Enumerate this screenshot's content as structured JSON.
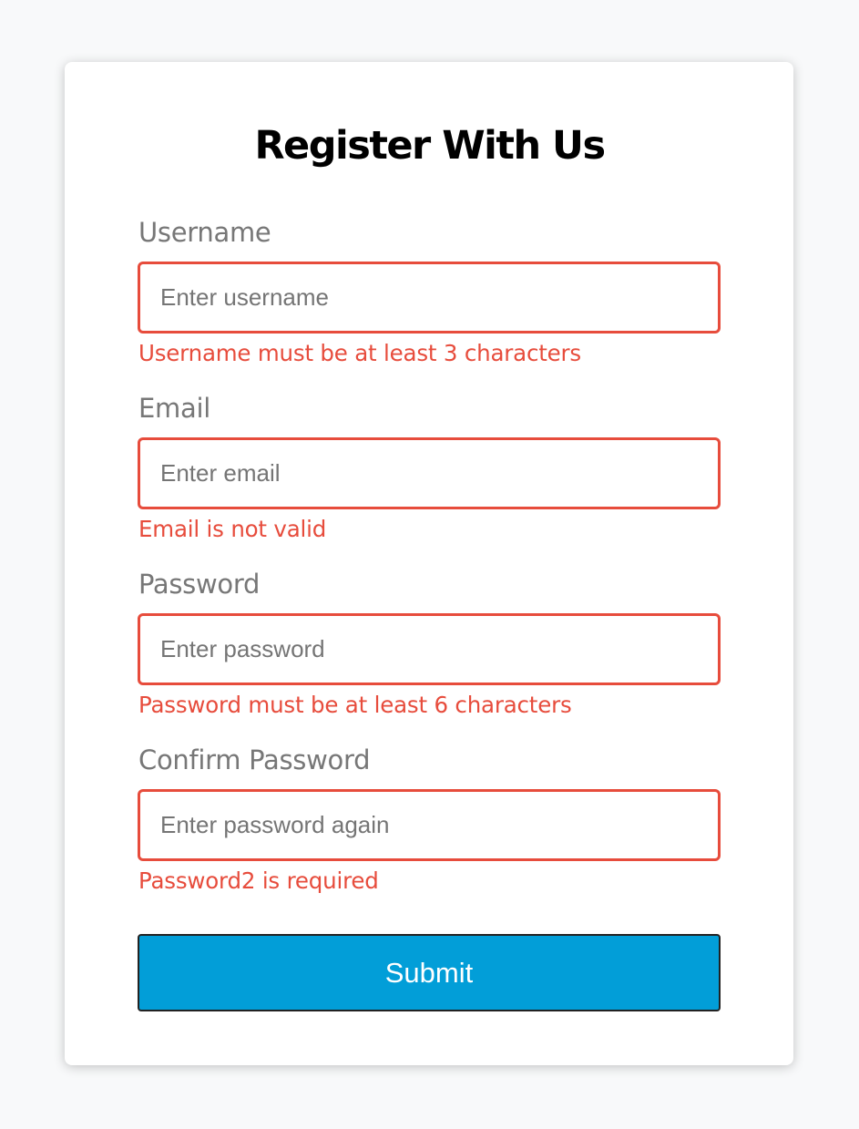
{
  "form": {
    "title": "Register With Us",
    "fields": [
      {
        "label": "Username",
        "placeholder": "Enter username",
        "type": "text",
        "error": "Username must be at least 3 characters"
      },
      {
        "label": "Email",
        "placeholder": "Enter email",
        "type": "text",
        "error": "Email is not valid"
      },
      {
        "label": "Password",
        "placeholder": "Enter password",
        "type": "password",
        "error": "Password must be at least 6 characters"
      },
      {
        "label": "Confirm Password",
        "placeholder": "Enter password again",
        "type": "password",
        "error": "Password2 is required"
      }
    ],
    "submit_label": "Submit"
  },
  "colors": {
    "page_background": "#f8f9fa",
    "card_background": "#ffffff",
    "error": "#e74c3c",
    "label": "#777777",
    "submit_background": "#029ed8"
  }
}
